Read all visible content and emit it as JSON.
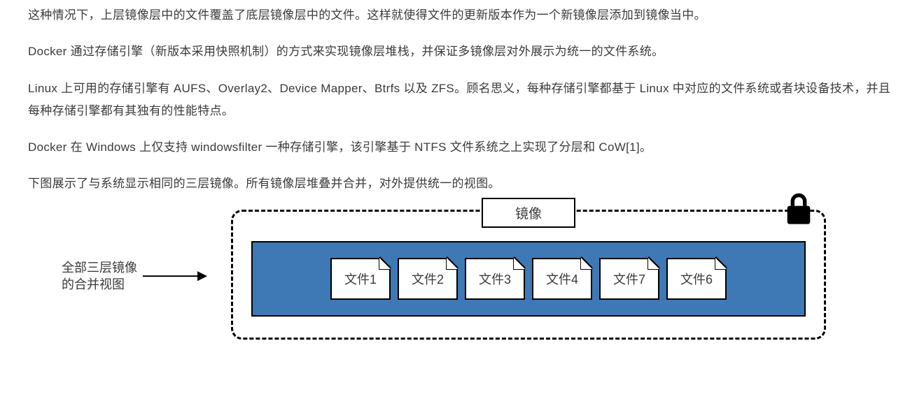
{
  "paragraphs": {
    "p1": "这种情况下，上层镜像层中的文件覆盖了底层镜像层中的文件。这样就使得文件的更新版本作为一个新镜像层添加到镜像当中。",
    "p2": "Docker 通过存储引擎（新版本采用快照机制）的方式来实现镜像层堆栈，并保证多镜像层对外展示为统一的文件系统。",
    "p3": "Linux 上可用的存储引擎有 AUFS、Overlay2、Device Mapper、Btrfs 以及 ZFS。顾名思义，每种存储引擎都基于 Linux 中对应的文件系统或者块设备技术，并且每种存储引擎都有其独有的性能特点。",
    "p4": "Docker 在 Windows 上仅支持 windowsfilter 一种存储引擎，该引擎基于 NTFS 文件系统之上实现了分层和 CoW[1]。",
    "p5": "下图展示了与系统显示相同的三层镜像。所有镜像层堆叠并合并，对外提供统一的视图。"
  },
  "figure": {
    "title_tab": "镜像",
    "caption_line1": "全部三层镜像",
    "caption_line2": "的合并视图",
    "files": {
      "f0": "文件1",
      "f1": "文件2",
      "f2": "文件3",
      "f3": "文件4",
      "f4": "文件7",
      "f5": "文件6"
    }
  }
}
